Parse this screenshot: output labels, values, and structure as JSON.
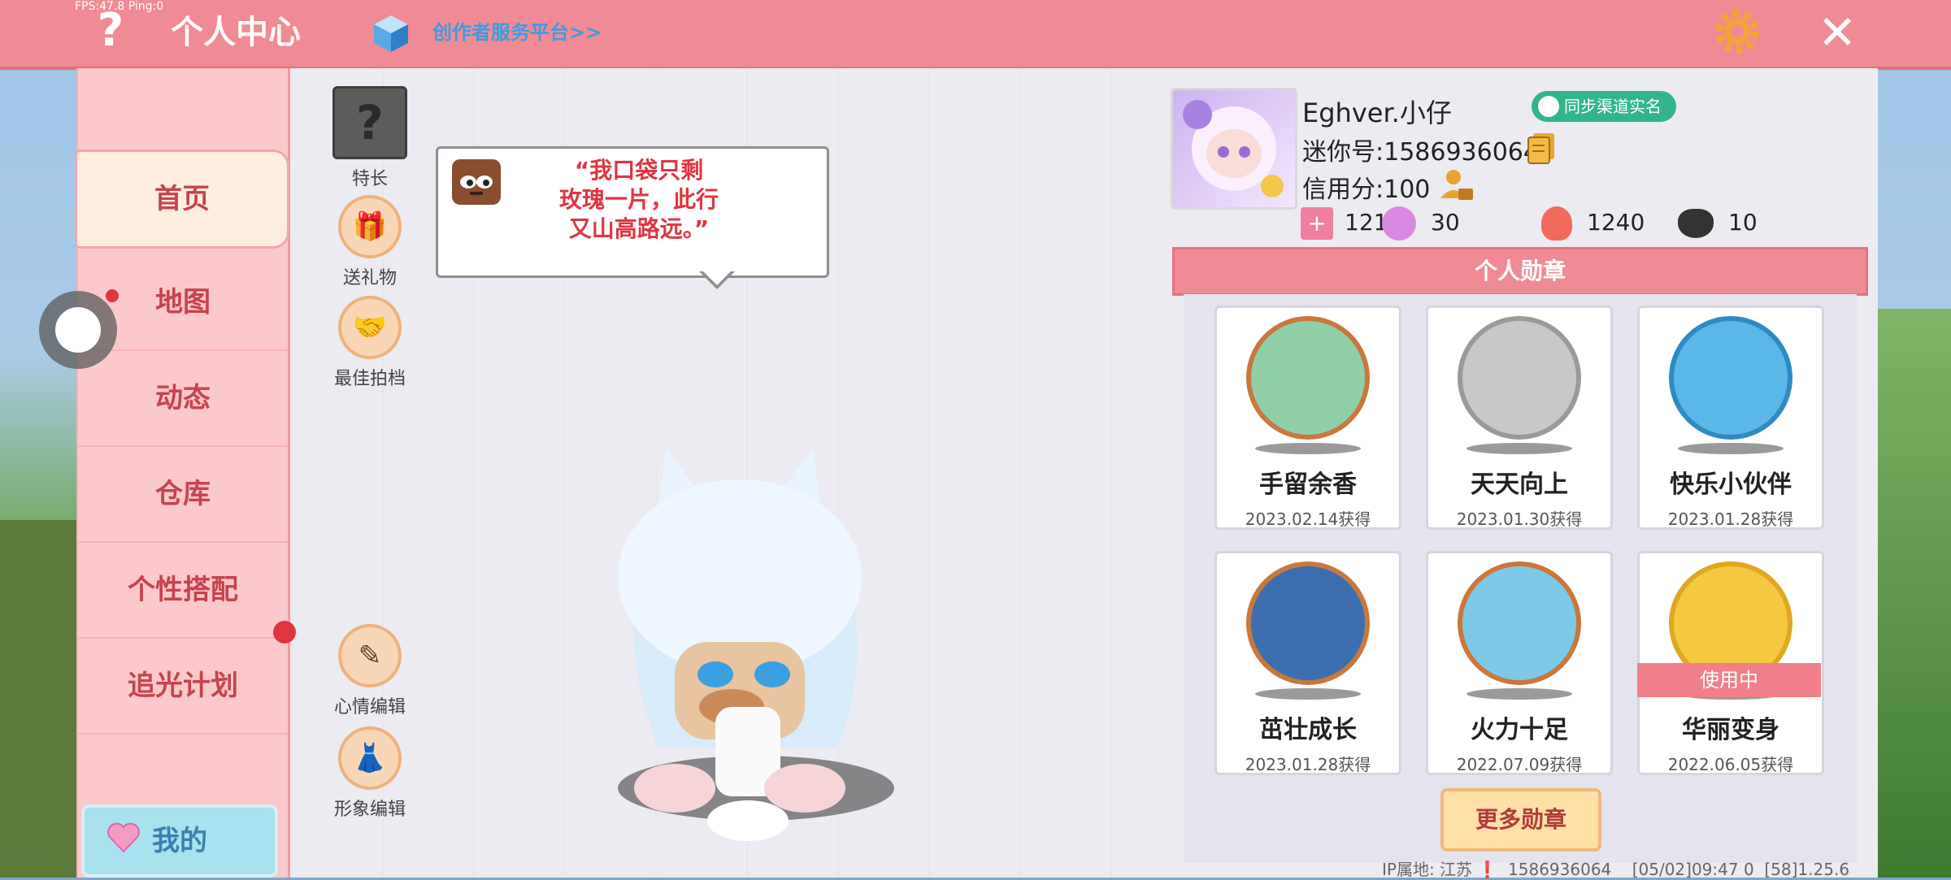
{
  "header": {
    "fps": "FPS:47.8  Ping:0",
    "help_label": "?",
    "title": "个人中心",
    "creator_link": "创作者服务平台>>",
    "close_label": "✕"
  },
  "sidebar": {
    "items": [
      {
        "label": "首页",
        "active": true
      },
      {
        "label": "地图"
      },
      {
        "label": "动态"
      },
      {
        "label": "仓库"
      },
      {
        "label": "个性搭配"
      },
      {
        "label": "追光计划"
      }
    ],
    "my_button": "我的"
  },
  "actions": {
    "talent": "特长",
    "gift": "送礼物",
    "partner": "最佳拍档",
    "mood_edit": "心情编辑",
    "image_edit": "形象编辑"
  },
  "bubble": {
    "text": "“我口袋只剩\n玫瑰一片，此行\n又山高路远。”"
  },
  "profile": {
    "username": "Eghver.小仔",
    "realname_badge": "同步渠道实名",
    "mini_id": "迷你号:1586936064",
    "credit": "信用分:100",
    "stats": {
      "level": "121",
      "fans": "30",
      "popularity": "1240",
      "likes": "10"
    }
  },
  "medals": {
    "header": "个人勋章",
    "items": [
      {
        "name": "手留余香",
        "date": "2023.02.14获得",
        "color": "#8fd0a6"
      },
      {
        "name": "天天向上",
        "date": "2023.01.30获得",
        "color": "#c8c8c8"
      },
      {
        "name": "快乐小伙伴",
        "date": "2023.01.28获得",
        "color": "#5ab8e8"
      },
      {
        "name": "茁壮成长",
        "date": "2023.01.28获得",
        "color": "#3c6fb0"
      },
      {
        "name": "火力十足",
        "date": "2022.07.09获得",
        "color": "#7ec8e8"
      },
      {
        "name": "华丽变身",
        "date": "2022.06.05获得",
        "color": "#f5c842"
      }
    ],
    "in_use": "使用中",
    "more": "更多勋章"
  },
  "footer": {
    "info": "IP属地: 江苏 ❗  1586936064    [05/02]09:47 0  [58]1.25.6"
  }
}
